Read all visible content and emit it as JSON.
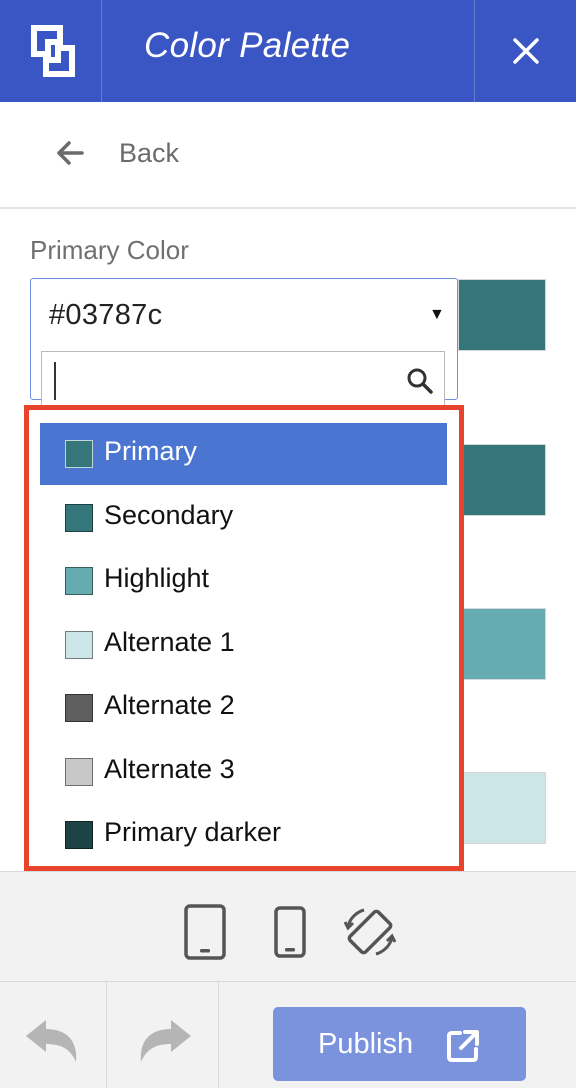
{
  "header": {
    "title": "Color Palette",
    "logo_icon": "brand-logo-icon",
    "close_icon": "close-icon"
  },
  "nav": {
    "back_label": "Back",
    "back_icon": "arrow-left-icon"
  },
  "field": {
    "label": "Primary Color",
    "selected_value": "#03787c",
    "dropdown_arrow": "▼",
    "search_value": "",
    "search_icon": "search-icon"
  },
  "swatches": [
    {
      "color": "#347679"
    },
    {
      "color": "#347679"
    },
    {
      "color": "#66abb0"
    },
    {
      "color": "#cce6e8"
    }
  ],
  "dropdown": {
    "options": [
      {
        "label": "Primary",
        "color": "#347679",
        "selected": true
      },
      {
        "label": "Secondary",
        "color": "#347679",
        "selected": false
      },
      {
        "label": "Highlight",
        "color": "#66abb0",
        "selected": false
      },
      {
        "label": "Alternate 1",
        "color": "#cce6e8",
        "selected": false
      },
      {
        "label": "Alternate 2",
        "color": "#5f5f5f",
        "selected": false
      },
      {
        "label": "Alternate 3",
        "color": "#c8c8c8",
        "selected": false
      },
      {
        "label": "Primary darker",
        "color": "#1e4347",
        "selected": false
      }
    ],
    "highlight_border_color": "#e8432c",
    "selected_bg": "#4a75d1"
  },
  "devices": [
    {
      "icon": "tablet-icon"
    },
    {
      "icon": "phone-icon"
    },
    {
      "icon": "rotate-icon"
    }
  ],
  "footer": {
    "undo_icon": "undo-icon",
    "redo_icon": "redo-icon",
    "publish_label": "Publish",
    "publish_icon": "external-link-icon"
  },
  "colors": {
    "header_bg": "#3a56c4",
    "publish_bg": "#7b93dc",
    "select_border": "#6f8fe0"
  }
}
